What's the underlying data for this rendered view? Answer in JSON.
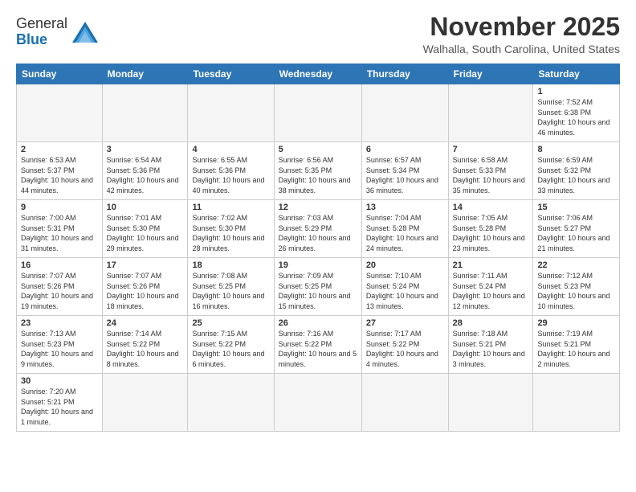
{
  "header": {
    "logo_general": "General",
    "logo_blue": "Blue",
    "month": "November 2025",
    "location": "Walhalla, South Carolina, United States"
  },
  "weekdays": [
    "Sunday",
    "Monday",
    "Tuesday",
    "Wednesday",
    "Thursday",
    "Friday",
    "Saturday"
  ],
  "weeks": [
    [
      {
        "day": "",
        "info": ""
      },
      {
        "day": "",
        "info": ""
      },
      {
        "day": "",
        "info": ""
      },
      {
        "day": "",
        "info": ""
      },
      {
        "day": "",
        "info": ""
      },
      {
        "day": "",
        "info": ""
      },
      {
        "day": "1",
        "info": "Sunrise: 7:52 AM\nSunset: 6:38 PM\nDaylight: 10 hours and 46 minutes."
      }
    ],
    [
      {
        "day": "2",
        "info": "Sunrise: 6:53 AM\nSunset: 5:37 PM\nDaylight: 10 hours and 44 minutes."
      },
      {
        "day": "3",
        "info": "Sunrise: 6:54 AM\nSunset: 5:36 PM\nDaylight: 10 hours and 42 minutes."
      },
      {
        "day": "4",
        "info": "Sunrise: 6:55 AM\nSunset: 5:36 PM\nDaylight: 10 hours and 40 minutes."
      },
      {
        "day": "5",
        "info": "Sunrise: 6:56 AM\nSunset: 5:35 PM\nDaylight: 10 hours and 38 minutes."
      },
      {
        "day": "6",
        "info": "Sunrise: 6:57 AM\nSunset: 5:34 PM\nDaylight: 10 hours and 36 minutes."
      },
      {
        "day": "7",
        "info": "Sunrise: 6:58 AM\nSunset: 5:33 PM\nDaylight: 10 hours and 35 minutes."
      },
      {
        "day": "8",
        "info": "Sunrise: 6:59 AM\nSunset: 5:32 PM\nDaylight: 10 hours and 33 minutes."
      }
    ],
    [
      {
        "day": "9",
        "info": "Sunrise: 7:00 AM\nSunset: 5:31 PM\nDaylight: 10 hours and 31 minutes."
      },
      {
        "day": "10",
        "info": "Sunrise: 7:01 AM\nSunset: 5:30 PM\nDaylight: 10 hours and 29 minutes."
      },
      {
        "day": "11",
        "info": "Sunrise: 7:02 AM\nSunset: 5:30 PM\nDaylight: 10 hours and 28 minutes."
      },
      {
        "day": "12",
        "info": "Sunrise: 7:03 AM\nSunset: 5:29 PM\nDaylight: 10 hours and 26 minutes."
      },
      {
        "day": "13",
        "info": "Sunrise: 7:04 AM\nSunset: 5:28 PM\nDaylight: 10 hours and 24 minutes."
      },
      {
        "day": "14",
        "info": "Sunrise: 7:05 AM\nSunset: 5:28 PM\nDaylight: 10 hours and 23 minutes."
      },
      {
        "day": "15",
        "info": "Sunrise: 7:06 AM\nSunset: 5:27 PM\nDaylight: 10 hours and 21 minutes."
      }
    ],
    [
      {
        "day": "16",
        "info": "Sunrise: 7:07 AM\nSunset: 5:26 PM\nDaylight: 10 hours and 19 minutes."
      },
      {
        "day": "17",
        "info": "Sunrise: 7:07 AM\nSunset: 5:26 PM\nDaylight: 10 hours and 18 minutes."
      },
      {
        "day": "18",
        "info": "Sunrise: 7:08 AM\nSunset: 5:25 PM\nDaylight: 10 hours and 16 minutes."
      },
      {
        "day": "19",
        "info": "Sunrise: 7:09 AM\nSunset: 5:25 PM\nDaylight: 10 hours and 15 minutes."
      },
      {
        "day": "20",
        "info": "Sunrise: 7:10 AM\nSunset: 5:24 PM\nDaylight: 10 hours and 13 minutes."
      },
      {
        "day": "21",
        "info": "Sunrise: 7:11 AM\nSunset: 5:24 PM\nDaylight: 10 hours and 12 minutes."
      },
      {
        "day": "22",
        "info": "Sunrise: 7:12 AM\nSunset: 5:23 PM\nDaylight: 10 hours and 10 minutes."
      }
    ],
    [
      {
        "day": "23",
        "info": "Sunrise: 7:13 AM\nSunset: 5:23 PM\nDaylight: 10 hours and 9 minutes."
      },
      {
        "day": "24",
        "info": "Sunrise: 7:14 AM\nSunset: 5:22 PM\nDaylight: 10 hours and 8 minutes."
      },
      {
        "day": "25",
        "info": "Sunrise: 7:15 AM\nSunset: 5:22 PM\nDaylight: 10 hours and 6 minutes."
      },
      {
        "day": "26",
        "info": "Sunrise: 7:16 AM\nSunset: 5:22 PM\nDaylight: 10 hours and 5 minutes."
      },
      {
        "day": "27",
        "info": "Sunrise: 7:17 AM\nSunset: 5:22 PM\nDaylight: 10 hours and 4 minutes."
      },
      {
        "day": "28",
        "info": "Sunrise: 7:18 AM\nSunset: 5:21 PM\nDaylight: 10 hours and 3 minutes."
      },
      {
        "day": "29",
        "info": "Sunrise: 7:19 AM\nSunset: 5:21 PM\nDaylight: 10 hours and 2 minutes."
      }
    ],
    [
      {
        "day": "30",
        "info": "Sunrise: 7:20 AM\nSunset: 5:21 PM\nDaylight: 10 hours and 1 minute."
      },
      {
        "day": "",
        "info": ""
      },
      {
        "day": "",
        "info": ""
      },
      {
        "day": "",
        "info": ""
      },
      {
        "day": "",
        "info": ""
      },
      {
        "day": "",
        "info": ""
      },
      {
        "day": "",
        "info": ""
      }
    ]
  ]
}
